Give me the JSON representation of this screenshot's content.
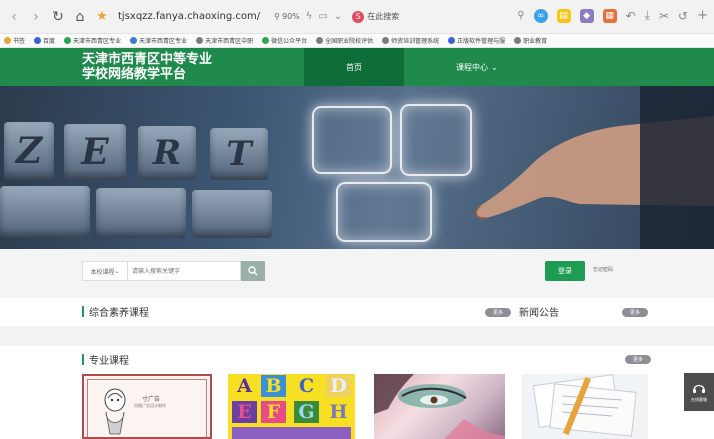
{
  "browser": {
    "url": "tjsxqzz.fanya.chaoxing.com/",
    "zoom": "90%",
    "search_placeholder": "在此搜索",
    "bookmarks": [
      {
        "label": "书签",
        "color": "#e8a33a"
      },
      {
        "label": "百度",
        "color": "#3b63d8"
      },
      {
        "label": "天津市西青区专业",
        "color": "#2ea44f"
      },
      {
        "label": "天津市西青区专业",
        "color": "#3b7bd8"
      },
      {
        "label": "天津市西青区中职",
        "color": "#7d7d7d"
      },
      {
        "label": "微信公众平台",
        "color": "#2ea44f"
      },
      {
        "label": "全国职业院校评估",
        "color": "#7d7d7d"
      },
      {
        "label": "师资培训管理系统",
        "color": "#7d7d7d"
      },
      {
        "label": "正版软件管理与服",
        "color": "#3b63d8"
      },
      {
        "label": "职业教育",
        "color": "#7d7d7d"
      }
    ]
  },
  "site": {
    "logo_line1": "天津市西青区中等专业",
    "logo_line2": "学校网络教学平台",
    "nav_home": "首页",
    "nav_course": "课程中心",
    "brand_color": "#1f8a4c"
  },
  "banner": {
    "keys": [
      "Z",
      "E",
      "R",
      "T"
    ]
  },
  "search": {
    "scope": "本校课程",
    "placeholder": "请输入搜索关键字",
    "login": "登录",
    "forget": "忘记密码"
  },
  "sections": {
    "general_title": "综合素养课程",
    "notice_title": "新闻公告",
    "professional_title": "专业课程",
    "more": "更多"
  },
  "courses": {
    "card1_title": "寸广告",
    "card1_sub": "风格广告设计制作",
    "letters": [
      "A",
      "B",
      "C",
      "D",
      "E",
      "F",
      "G",
      "H"
    ]
  },
  "float_tool": "在线客服"
}
